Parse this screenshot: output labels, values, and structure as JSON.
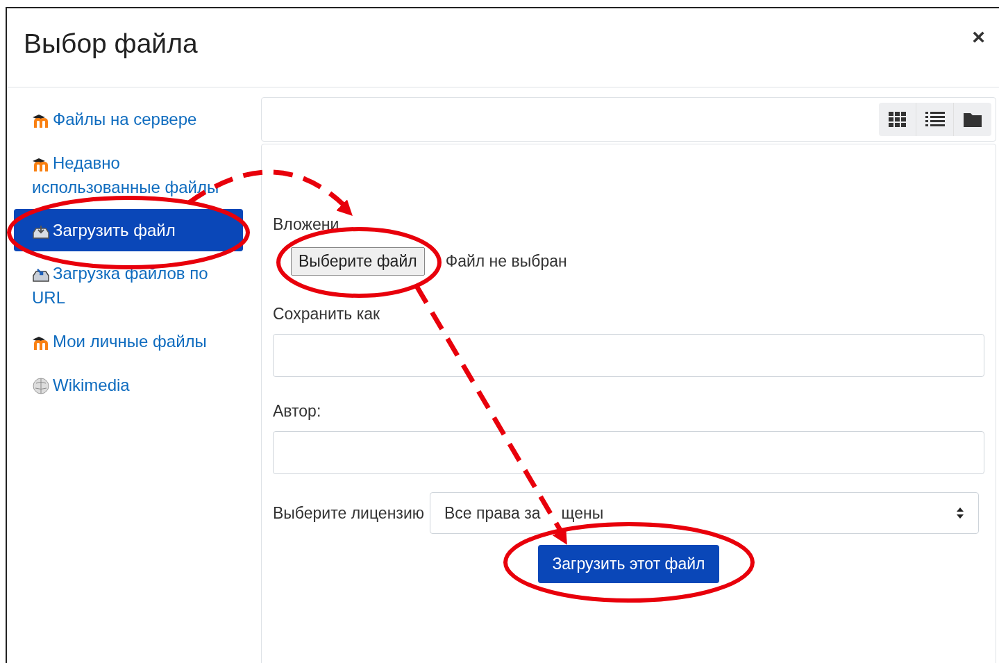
{
  "window": {
    "title": "Выбор файла",
    "close_label": "×"
  },
  "sidebar": {
    "items": [
      {
        "label": "Файлы на сервере",
        "kind": "moodle",
        "selected": false
      },
      {
        "label": "Недавно использованные файлы",
        "kind": "moodle",
        "selected": false
      },
      {
        "label": "Загрузить файл",
        "kind": "upload",
        "selected": true
      },
      {
        "label": "Загрузка файлов по URL",
        "kind": "url",
        "selected": false
      },
      {
        "label": "Мои личные файлы",
        "kind": "moodle",
        "selected": false
      },
      {
        "label": "Wikimedia",
        "kind": "wiki",
        "selected": false
      }
    ]
  },
  "form": {
    "attachment_label": "Вложени",
    "choose_button": "Выберите файл",
    "no_file_text": "Файл не выбран",
    "save_as_label": "Сохранить как",
    "author_label": "Автор:",
    "license_label": "Выберите лицензию",
    "license_value": "Все права за",
    "license_value_end": "щены",
    "submit_button": "Загрузить этот файл"
  }
}
